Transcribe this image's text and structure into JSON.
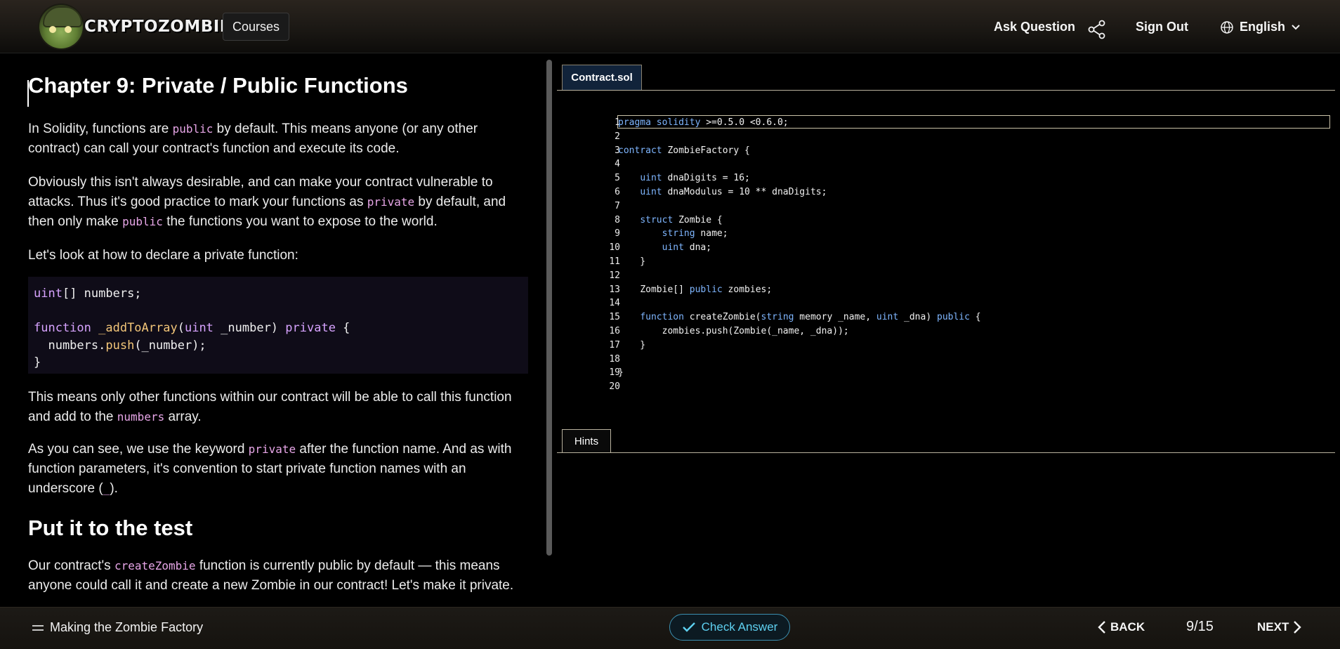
{
  "header": {
    "logo_text": "CRYPTOZOMBIES",
    "courses_label": "Courses",
    "ask_question_label": "Ask Question",
    "share_icon": "share-icon",
    "sign_out_label": "Sign Out",
    "language_label": "English"
  },
  "lesson": {
    "title": "Chapter 9: Private / Public Functions",
    "p1": {
      "a": "In Solidity, functions are ",
      "code": "public",
      "b": " by default. This means anyone (or any other contract) can call your contract's function and execute its code."
    },
    "p2": {
      "a": "Obviously this isn't always desirable, and can make your contract vulnerable to attacks. Thus it's good practice to mark your functions as ",
      "code1": "private",
      "b": " by default, and then only make ",
      "code2": "public",
      "c": " the functions you want to expose to the world."
    },
    "p3": "Let's look at how to declare a private function:",
    "example": {
      "l1_type": "uint",
      "l1_rest": "[] numbers;",
      "l3_kw": "function",
      "l3_name": " _addToArray",
      "l3_open": "(",
      "l3_type": "uint",
      "l3_param": " _number) ",
      "l3_mod": "private",
      "l3_brace": " {",
      "l4_obj": "  numbers.",
      "l4_fn": "push",
      "l4_rest": "(_number);",
      "l5": "}"
    },
    "p4": {
      "a": "This means only other functions within our contract will be able to call this function and add to the ",
      "code": "numbers",
      "b": " array."
    },
    "p5": {
      "a": "As you can see, we use the keyword ",
      "code": "private",
      "b": " after the function name. And as with function parameters, it's convention to start private function names with an underscore (",
      "code2": "_",
      "c": ")."
    },
    "h2": "Put it to the test",
    "p6": {
      "a": "Our contract's ",
      "code": "createZombie",
      "b": " function is currently public by default — this means anyone could call it and create a new Zombie in our contract! Let's make it private."
    }
  },
  "editor": {
    "file_tab": "Contract.sol",
    "hints_tab": "Hints",
    "line_numbers": [
      "1",
      "2",
      "3",
      "4",
      "5",
      "6",
      "7",
      "8",
      "9",
      "10",
      "11",
      "12",
      "13",
      "14",
      "15",
      "16",
      "17",
      "18",
      "19",
      "20"
    ],
    "lines": {
      "l1": {
        "kw": "pragma solidity",
        "rest": " >=0.5.0 <0.6.0;"
      },
      "l3": {
        "kw": "contract",
        "rest": " ZombieFactory {"
      },
      "l5": {
        "indent": "    ",
        "ty": "uint",
        "rest": " dnaDigits = 16;"
      },
      "l6": {
        "indent": "    ",
        "ty": "uint",
        "rest": " dnaModulus = 10 ** dnaDigits;"
      },
      "l8": {
        "indent": "    ",
        "kw": "struct",
        "rest": " Zombie {"
      },
      "l9": {
        "indent": "        ",
        "ty": "string",
        "rest": " name;"
      },
      "l10": {
        "indent": "        ",
        "ty": "uint",
        "rest": " dna;"
      },
      "l11": "    }",
      "l13": {
        "indent": "    ",
        "a": "Zombie[] ",
        "kw": "public",
        "rest": " zombies;"
      },
      "l15": {
        "indent": "    ",
        "kw": "function",
        "a": " createZombie(",
        "ty1": "string",
        "b": " memory _name, ",
        "ty2": "uint",
        "c": " _dna) ",
        "kw2": "public",
        "d": " {"
      },
      "l16": "        zombies.push(Zombie(_name, _dna));",
      "l17": "    }",
      "l19": "}"
    }
  },
  "footer": {
    "course_title": "Making the Zombie Factory",
    "check_answer_label": "Check Answer",
    "back_label": "BACK",
    "progress": "9/15",
    "next_label": "NEXT"
  }
}
